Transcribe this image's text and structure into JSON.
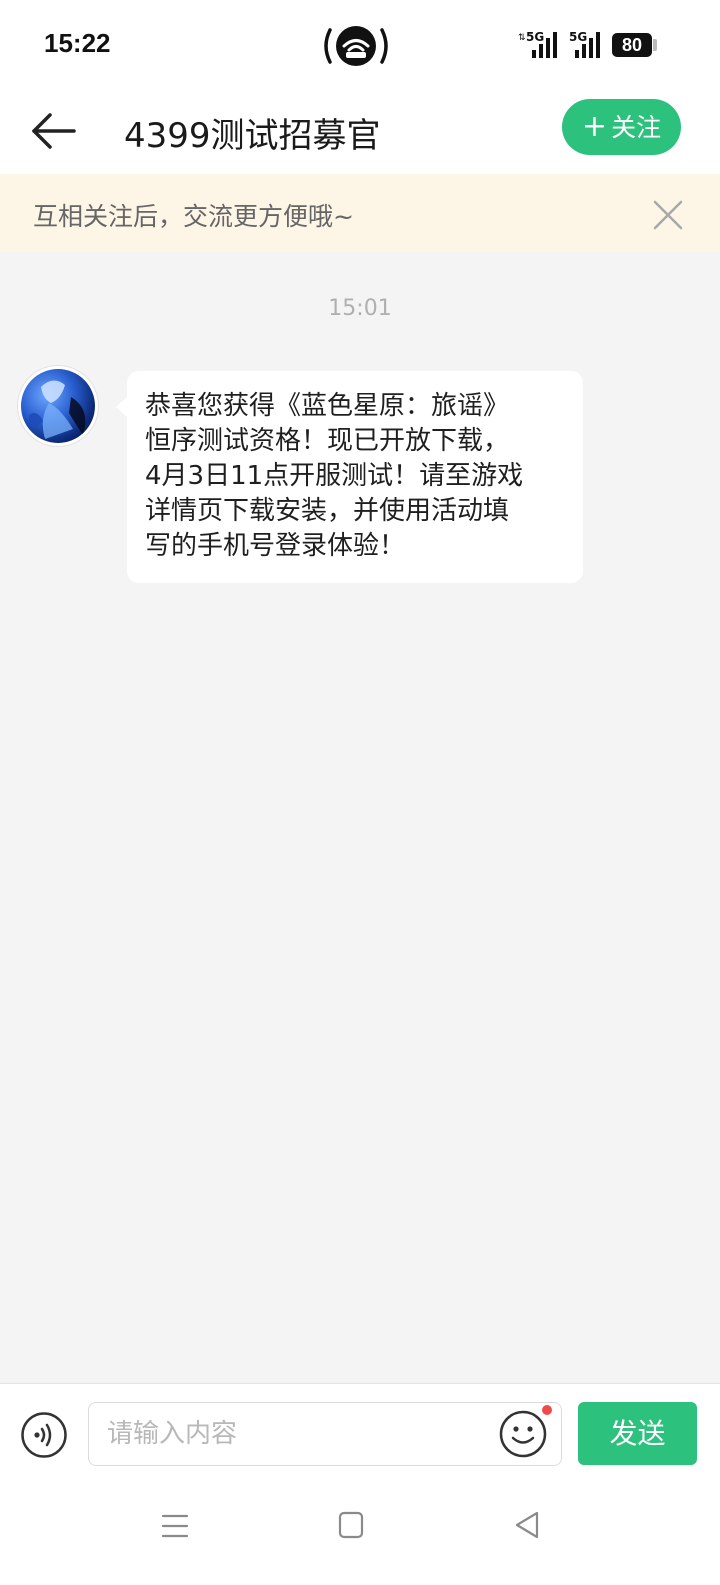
{
  "status_bar": {
    "time": "15:22",
    "battery": "80",
    "icons": [
      "hotspot-icon",
      "signal-5g-icon",
      "signal-5g-icon",
      "battery-icon"
    ]
  },
  "header": {
    "title": "4399测试招募官",
    "follow_label": "关注",
    "follow_icon": "plus-icon",
    "back_icon": "arrow-left-icon"
  },
  "notice": {
    "text": "互相关注后，交流更方便哦~",
    "close_icon": "close-icon"
  },
  "messages": [
    {
      "timestamp": "15:01",
      "sender_avatar": "avatar-image",
      "text": "恭喜您获得《蓝色星原：旅谣》\n恒序测试资格！现已开放下载，\n4月3日11点开服测试！请至游戏\n详情页下载安装，并使用活动填\n写的手机号登录体验！"
    }
  ],
  "input_bar": {
    "placeholder": "请输入内容",
    "value": "",
    "send_label": "发送",
    "voice_icon": "voice-icon",
    "emoji_icon": "emoji-icon"
  },
  "nav_bar": {
    "icons": [
      "menu-icon",
      "home-square-icon",
      "back-triangle-icon"
    ]
  },
  "colors": {
    "accent": "#2cc17d",
    "notice_bg": "#fdf5e6",
    "chat_bg": "#f4f4f4",
    "badge_dot": "#f04b4b"
  }
}
